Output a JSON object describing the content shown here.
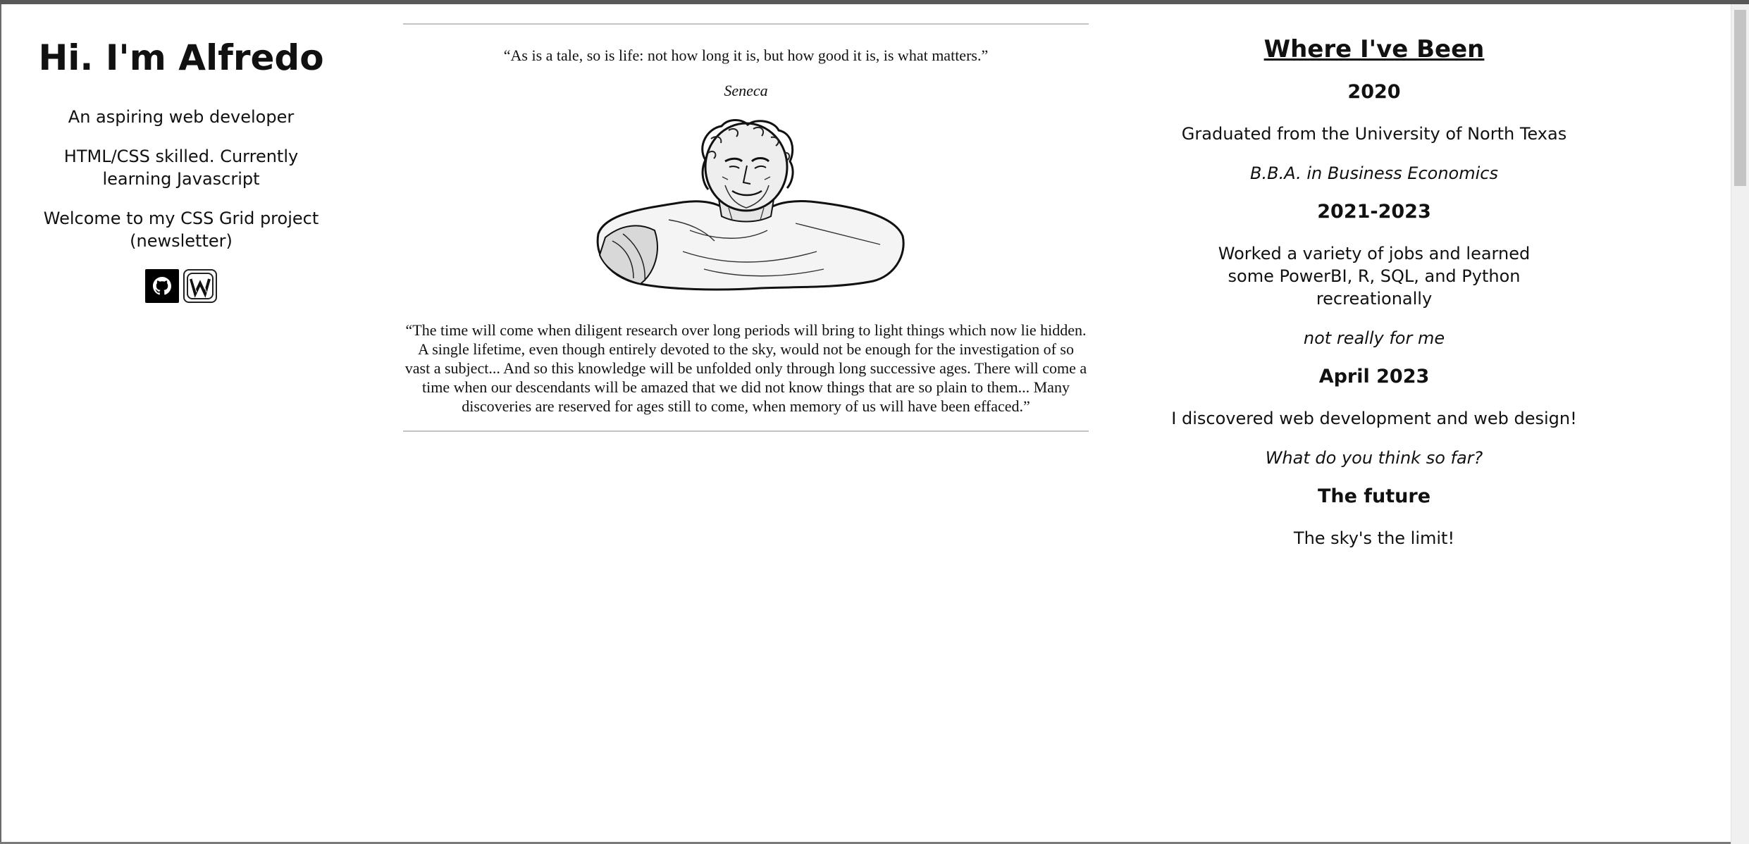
{
  "intro": {
    "title": "Hi. I'm Alfredo",
    "tagline": "An aspiring web developer",
    "skills": "HTML/CSS skilled. Currently learning Javascript",
    "welcome": "Welcome to my CSS Grid project (newsletter)",
    "social_icons": [
      "github-icon",
      "wordpress-icon"
    ]
  },
  "quotes": {
    "short_quote": "“As is a tale, so is life: not how long it is, but how good it is, is what matters.”",
    "author": "Seneca",
    "image": "seneca-bust-engraving",
    "long_quote": "“The time will come when diligent research over long periods will bring to light things which now lie hidden. A single lifetime, even though entirely devoted to the sky, would not be enough for the investigation of so vast a subject... And so this knowledge will be unfolded only through long successive ages. There will come a time when our descendants will be amazed that we did not know things that are so plain to them... Many discoveries are reserved for ages still to come, when memory of us will have been effaced.”"
  },
  "timeline": {
    "heading": "Where I've Been",
    "entries": [
      {
        "year": "2020",
        "text": "Graduated from the University of North Texas",
        "note": "B.B.A. in Business Economics"
      },
      {
        "year": "2021-2023",
        "text": "Worked a variety of jobs and learned some PowerBI, R, SQL, and Python recreationally",
        "note": "not really for me"
      },
      {
        "year": "April 2023",
        "text": "I discovered web development and web design!",
        "note": "What do you think so far?"
      },
      {
        "year": "The future",
        "text": "The sky's the limit!"
      }
    ]
  },
  "colors": {
    "text": "#111111",
    "background": "#ffffff",
    "rule": "#c4c4c4"
  }
}
